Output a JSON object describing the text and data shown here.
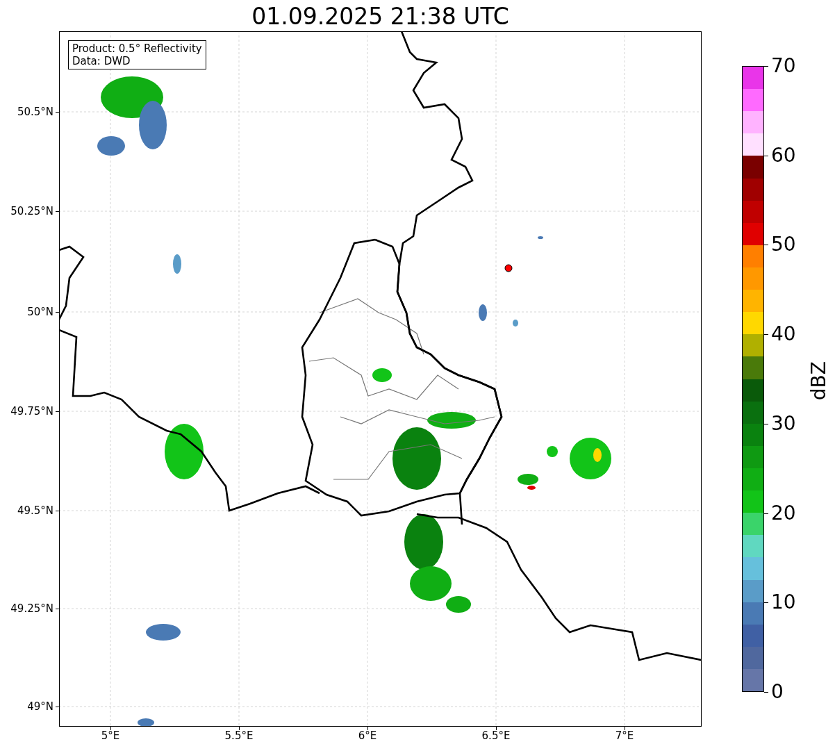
{
  "title": "01.09.2025 21:38 UTC",
  "legend": [
    "Product: 0.5° Reflectivity",
    "Data: DWD"
  ],
  "y_ticks": [
    "50.5°N",
    "50.25°N",
    "50°N",
    "49.75°N",
    "49.5°N",
    "49.25°N",
    "49°N"
  ],
  "x_ticks": [
    "5°E",
    "5.5°E",
    "6°E",
    "6.5°E",
    "7°E"
  ],
  "colorbar": {
    "label": "dBZ",
    "ticks": [
      "70",
      "60",
      "50",
      "40",
      "30",
      "20",
      "10",
      "0"
    ],
    "bands": [
      {
        "color": "#e935e9"
      },
      {
        "color": "#ff6aff"
      },
      {
        "color": "#ffb3ff"
      },
      {
        "color": "#ffe0ff"
      },
      {
        "color": "#7a0000"
      },
      {
        "color": "#a00000"
      },
      {
        "color": "#c00000"
      },
      {
        "color": "#e00000"
      },
      {
        "color": "#ff7f00"
      },
      {
        "color": "#ff9800"
      },
      {
        "color": "#ffb400"
      },
      {
        "color": "#ffd800"
      },
      {
        "color": "#b0b000"
      },
      {
        "color": "#4a7a0a"
      },
      {
        "color": "#0a5a0a"
      },
      {
        "color": "#0a700f"
      },
      {
        "color": "#0a820f"
      },
      {
        "color": "#0f9a12"
      },
      {
        "color": "#10ae14"
      },
      {
        "color": "#12c418"
      },
      {
        "color": "#3ad46a"
      },
      {
        "color": "#60d8c0"
      },
      {
        "color": "#66c0dc"
      },
      {
        "color": "#5a9cc8"
      },
      {
        "color": "#4a7ab4"
      },
      {
        "color": "#4060a4"
      },
      {
        "color": "#50689e"
      },
      {
        "color": "#6676a8"
      }
    ]
  }
}
